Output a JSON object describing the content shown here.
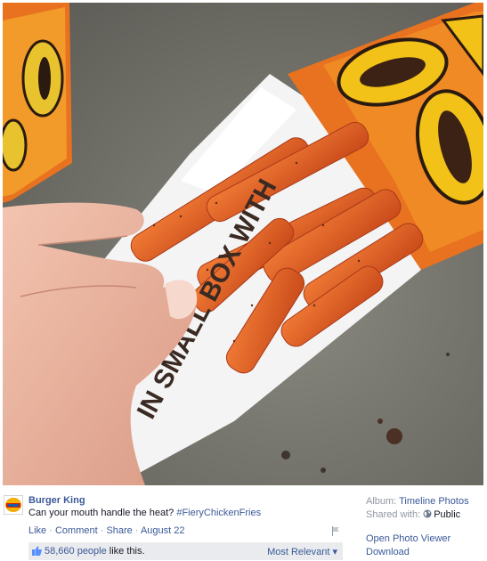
{
  "post": {
    "page_name": "Burger King",
    "caption_text": "Can your mouth handle the heat?",
    "hashtag": "#FieryChickenFries",
    "actions": {
      "like": "Like",
      "comment": "Comment",
      "share": "Share",
      "date": "August 22",
      "separator": " · "
    },
    "likes": {
      "count_text": "58,660 people",
      "suffix": " like this."
    },
    "sort_label": "Most Relevant",
    "sort_caret": "▾"
  },
  "sidebar": {
    "album_label": "Album:",
    "album_value": "Timeline Photos",
    "shared_label": "Shared with:",
    "shared_value": "Public",
    "open_viewer": "Open Photo Viewer",
    "download": "Download"
  },
  "photo": {
    "box_text": "IN SMALL BOX WITH",
    "box_text_partial": "BOX"
  },
  "icons": [
    "burger-king-logo",
    "flag-icon",
    "thumb-up-icon",
    "globe-icon"
  ],
  "colors": {
    "link": "#3b5998",
    "muted": "#9197a3",
    "bar": "#e9ebee",
    "fries": "#e0632a"
  }
}
